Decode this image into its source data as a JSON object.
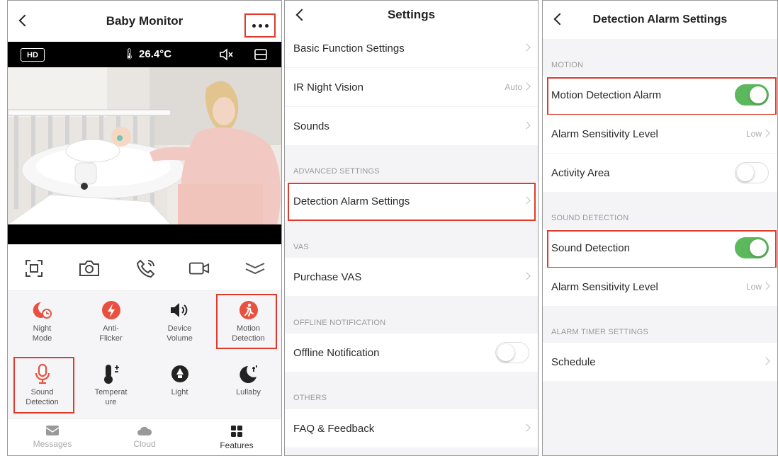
{
  "monitor": {
    "title": "Baby Monitor",
    "hd_label": "HD",
    "temperature": "26.4°C",
    "controls": [
      "screenshot-icon",
      "camera-icon",
      "call-icon",
      "record-icon",
      "collapse-icon"
    ],
    "features": [
      {
        "label": "Night\nMode",
        "icon": "night-mode-icon"
      },
      {
        "label": "Anti-\nFlicker",
        "icon": "anti-flicker-icon"
      },
      {
        "label": "Device\nVolume",
        "icon": "volume-icon"
      },
      {
        "label": "Motion\nDetection",
        "icon": "motion-icon"
      },
      {
        "label": "Sound\nDetection",
        "icon": "microphone-icon"
      },
      {
        "label": "Temperat\nure",
        "icon": "thermometer-icon"
      },
      {
        "label": "Light",
        "icon": "light-icon"
      },
      {
        "label": "Lullaby",
        "icon": "lullaby-icon"
      }
    ],
    "tabs": [
      {
        "label": "Messages",
        "icon": "messages-icon"
      },
      {
        "label": "Cloud",
        "icon": "cloud-icon"
      },
      {
        "label": "Features",
        "icon": "features-icon"
      }
    ],
    "accent": "#e8513f",
    "highlight": "#e03a2c"
  },
  "settings": {
    "title": "Settings",
    "items": {
      "basic": "Basic Function Settings",
      "ir": "IR Night Vision",
      "ir_value": "Auto",
      "sounds": "Sounds",
      "detection": "Detection Alarm Settings",
      "purchase": "Purchase VAS",
      "offline": "Offline Notification",
      "faq": "FAQ & Feedback"
    },
    "sections": {
      "advanced": "ADVANCED SETTINGS",
      "vas": "VAS",
      "offline": "OFFLINE NOTIFICATION",
      "others": "OTHERS"
    },
    "offline_notification_on": false
  },
  "detection": {
    "title": "Detection Alarm Settings",
    "sections": {
      "motion": "MOTION",
      "sound": "SOUND DETECTION",
      "timer": "ALARM TIMER SETTINGS"
    },
    "items": {
      "motion_alarm": "Motion Detection Alarm",
      "motion_sensitivity": "Alarm Sensitivity Level",
      "motion_sensitivity_value": "Low",
      "activity_area": "Activity Area",
      "sound_detection": "Sound Detection",
      "sound_sensitivity": "Alarm Sensitivity Level",
      "sound_sensitivity_value": "Low",
      "schedule": "Schedule"
    },
    "toggles": {
      "motion_alarm": true,
      "activity_area": false,
      "sound_detection": true
    },
    "toggle_on_color": "#5cb85c"
  }
}
